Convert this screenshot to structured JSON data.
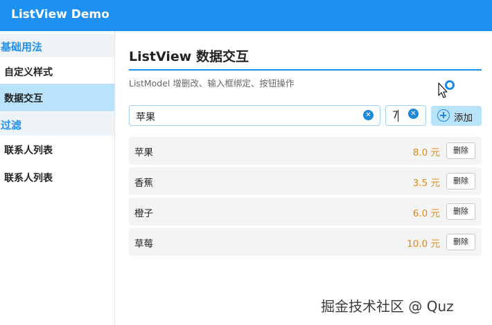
{
  "window": {
    "title": "ListView Demo"
  },
  "sidebar": {
    "groups": [
      {
        "label": "基础用法",
        "items": [
          "自定义样式",
          "数据交互"
        ]
      },
      {
        "label": "过滤",
        "items": [
          "联系人列表",
          "联系人列表"
        ]
      }
    ],
    "active_item": "数据交互"
  },
  "main": {
    "title": "ListView 数据交互",
    "subtitle": "ListModel 增删改、输入框绑定、按钮操作",
    "name_input": {
      "value": "苹果"
    },
    "price_input": {
      "value": "7"
    },
    "add_button": {
      "label": "添加"
    },
    "items": [
      {
        "name": "苹果",
        "price": "8.0 元",
        "delete_label": "删除"
      },
      {
        "name": "香蕉",
        "price": "3.5 元",
        "delete_label": "删除"
      },
      {
        "name": "橙子",
        "price": "6.0 元",
        "delete_label": "删除"
      },
      {
        "name": "草莓",
        "price": "10.0 元",
        "delete_label": "删除"
      }
    ]
  },
  "watermark": "掘金技术社区 @ Quz",
  "colors": {
    "accent": "#1e90f0",
    "selected_bg": "#b9e3fd",
    "price": "#dd8a1c"
  },
  "icons": {
    "clear": "clear-circle-icon",
    "add": "plus-circle-icon",
    "cursor": "busy-cursor-icon"
  }
}
